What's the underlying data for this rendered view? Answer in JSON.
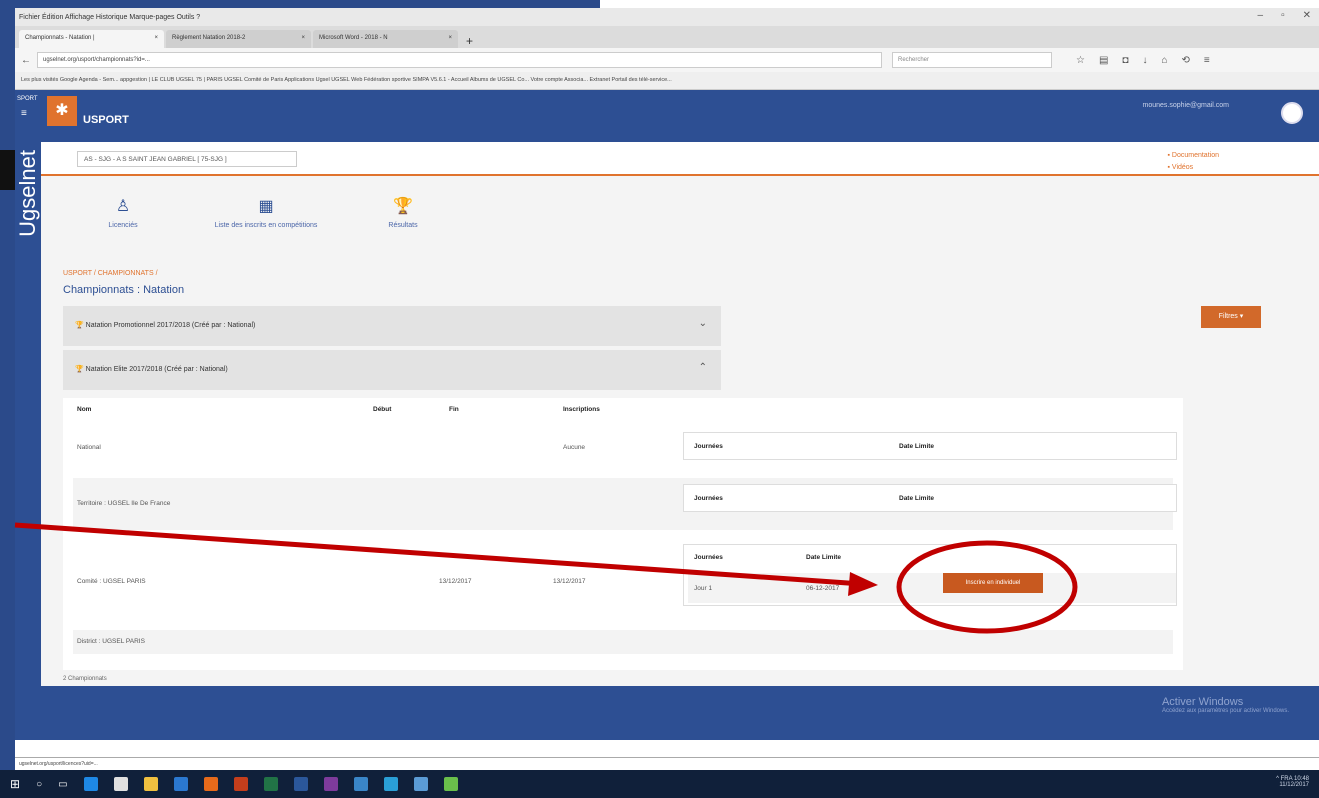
{
  "browser": {
    "menu": "Fichier  Édition  Affichage  Historique  Marque-pages  Outils  ?",
    "tabs": [
      {
        "label": "Championnats - Natation |"
      },
      {
        "label": "Règlement Natation 2018-2"
      },
      {
        "label": "Microsoft Word - 2018 - N"
      }
    ],
    "url": "ugselnet.org/usport/championnats?id=...",
    "search_placeholder": "Rechercher",
    "bookmarks": "Les plus visités   Google Agenda - Sem...   appgestion | LE CLUB   UGSEL 75 | PARIS   UGSEL Comité de Paris   Applications Ugsel   UGSEL Web   Fédération sportive   SIMPA V5.6.1 - Accueil   Albums de UGSEL Co...   Votre compte Associa...   Extranet   Portail des télé-service...",
    "status_url": "ugselnet.org/usport/licences?uid=..."
  },
  "app": {
    "sidebar_label": "SPORT",
    "vertical_title": "Ugselnet",
    "brand": "USPORT",
    "user_email": "mounes.sophie@gmail.com",
    "school": "AS - SJG - A S SAINT JEAN GABRIEL [ 75-SJG ]",
    "documentation": "Documentation",
    "videos": "Vidéos",
    "shortcuts": [
      {
        "label": "Licenciés"
      },
      {
        "label": "Liste des inscrits en compétitions"
      },
      {
        "label": "Résultats"
      }
    ],
    "breadcrumb": "USPORT / CHAMPIONNATS /",
    "page_title": "Championnats : Natation",
    "filters_label": "Filtres ▾",
    "championships": [
      {
        "label": "Natation Promotionnel 2017/2018 (Créé par : National)",
        "chevron": "⌄"
      },
      {
        "label": "Natation Elite 2017/2018 (Créé par : National)",
        "chevron": "⌃"
      }
    ],
    "table": {
      "headers": [
        "Nom",
        "Début",
        "Fin",
        "Inscriptions"
      ],
      "rows": [
        {
          "nom": "National",
          "debut": "",
          "fin": "",
          "inscriptions": "Aucune"
        },
        {
          "nom": "Territoire : UGSEL Ile De France",
          "debut": "",
          "fin": "",
          "inscriptions": ""
        },
        {
          "nom": "Comité : UGSEL PARIS",
          "debut": "13/12/2017",
          "fin": "13/12/2017",
          "inscriptions": ""
        },
        {
          "nom": "District : UGSEL PARIS",
          "debut": "",
          "fin": "",
          "inscriptions": ""
        }
      ],
      "sub_headers": [
        "Journées",
        "Date Limite"
      ],
      "comite_day": "Jour 1",
      "comite_date": "06-12-2017",
      "inscrire_label": "Inscrire en individuel"
    },
    "count": "2 Championnats",
    "activate_title": "Activer Windows",
    "activate_sub": "Accédez aux paramètres pour activer Windows."
  },
  "taskbar": {
    "tray": "^  FRA",
    "time": "10:48",
    "date": "11/12/2017"
  },
  "colors": {
    "primary": "#2d4f93",
    "accent": "#e0732e",
    "annotation": "#c00000"
  }
}
